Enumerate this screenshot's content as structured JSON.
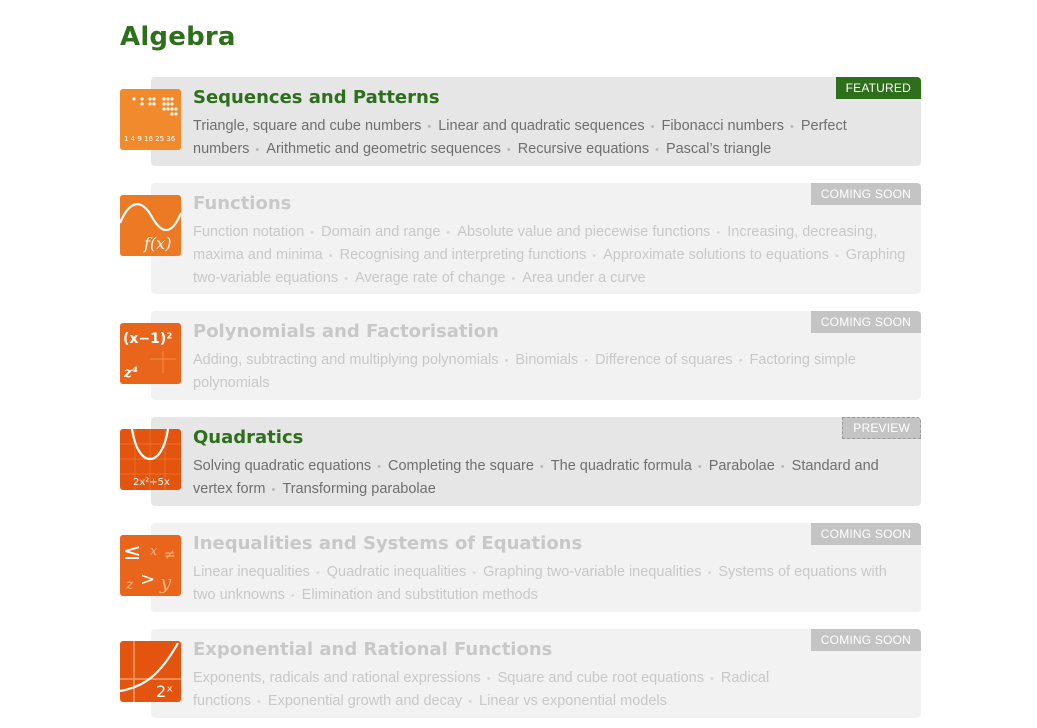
{
  "section_title": "Algebra",
  "colors": {
    "accent_green": "#2e6f1c",
    "thumb_orange": "#e35c16",
    "badge_grey": "#c4c4c4"
  },
  "courses": [
    {
      "title": "Sequences and Patterns",
      "badge": "FEATURED",
      "icon": "sequences-thumbnail",
      "thumb_text": "1 4 9 16 25 36",
      "topics": [
        "Triangle, square and cube numbers",
        "Linear and quadratic sequences",
        "Fibonacci numbers",
        "Perfect numbers",
        "Arithmetic and geometric sequences",
        "Recursive equations",
        "Pascal’s triangle"
      ]
    },
    {
      "title": "Functions",
      "badge": "COMING SOON",
      "icon": "functions-thumbnail",
      "thumb_text": "f(x)",
      "topics": [
        "Function notation",
        "Domain and range",
        "Absolute value and piecewise functions",
        "Increasing, decreasing, maxima and minima",
        "Recognising and interpreting functions",
        "Approximate solutions to equations",
        "Graphing two-variable equations",
        "Average rate of change",
        "Area under a curve"
      ]
    },
    {
      "title": "Polynomials and Factorisation",
      "badge": "COMING SOON",
      "icon": "polynomials-thumbnail",
      "thumb_text": "(x−1)²",
      "thumb_text_2": "z⁴",
      "topics": [
        "Adding, subtracting and multiplying polynomials",
        "Binomials",
        "Difference of squares",
        "Factoring simple polynomials"
      ]
    },
    {
      "title": "Quadratics",
      "badge": "PREVIEW",
      "icon": "quadratics-thumbnail",
      "thumb_text": "2x²+5x",
      "topics": [
        "Solving quadratic equations",
        "Completing the square",
        "The quadratic formula",
        "Parabolae",
        "Standard and vertex form",
        "Transforming parabolae"
      ]
    },
    {
      "title": "Inequalities and Systems of Equations",
      "badge": "COMING SOON",
      "icon": "inequalities-thumbnail",
      "thumb_text": "≤",
      "thumb_text_2": "x",
      "thumb_text_3": "≠",
      "thumb_text_4": "z",
      "thumb_text_5": ">",
      "thumb_text_6": "y",
      "topics": [
        "Linear inequalities",
        "Quadratic inequalities",
        "Graphing two-variable inequalities",
        "Systems of equations with two unknowns",
        "Elimination and substitution methods"
      ]
    },
    {
      "title": "Exponential and Rational Functions",
      "badge": "COMING SOON",
      "icon": "exponential-thumbnail",
      "thumb_text": "2ˣ",
      "topics": [
        "Exponents, radicals and rational expressions",
        "Square and cube root equations",
        "Radical functions",
        "Exponential growth and decay",
        "Linear vs exponential models"
      ]
    }
  ]
}
